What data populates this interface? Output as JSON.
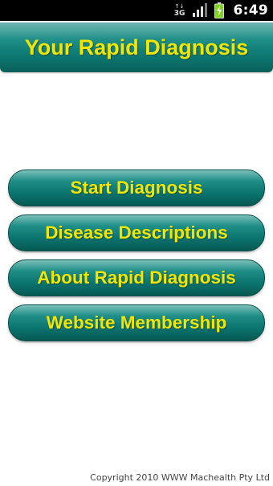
{
  "status_bar": {
    "network_label": "3G",
    "network_arrows": "↑↓",
    "time": "6:49",
    "signal_icon": "signal-bars-icon",
    "battery_icon": "battery-charging-icon",
    "colors": {
      "background": "#000000",
      "battery": "#7ed321"
    }
  },
  "header": {
    "title": "Your Rapid Diagnosis"
  },
  "menu": {
    "items": [
      {
        "label": "Start Diagnosis"
      },
      {
        "label": "Disease Descriptions"
      },
      {
        "label": "About Rapid Diagnosis"
      },
      {
        "label": "Website Membership"
      }
    ]
  },
  "footer": {
    "copyright": "Copyright 2010 WWW Machealth Pty Ltd"
  },
  "theme": {
    "accent_teal": "#0d7972",
    "text_yellow": "#f2e600"
  }
}
